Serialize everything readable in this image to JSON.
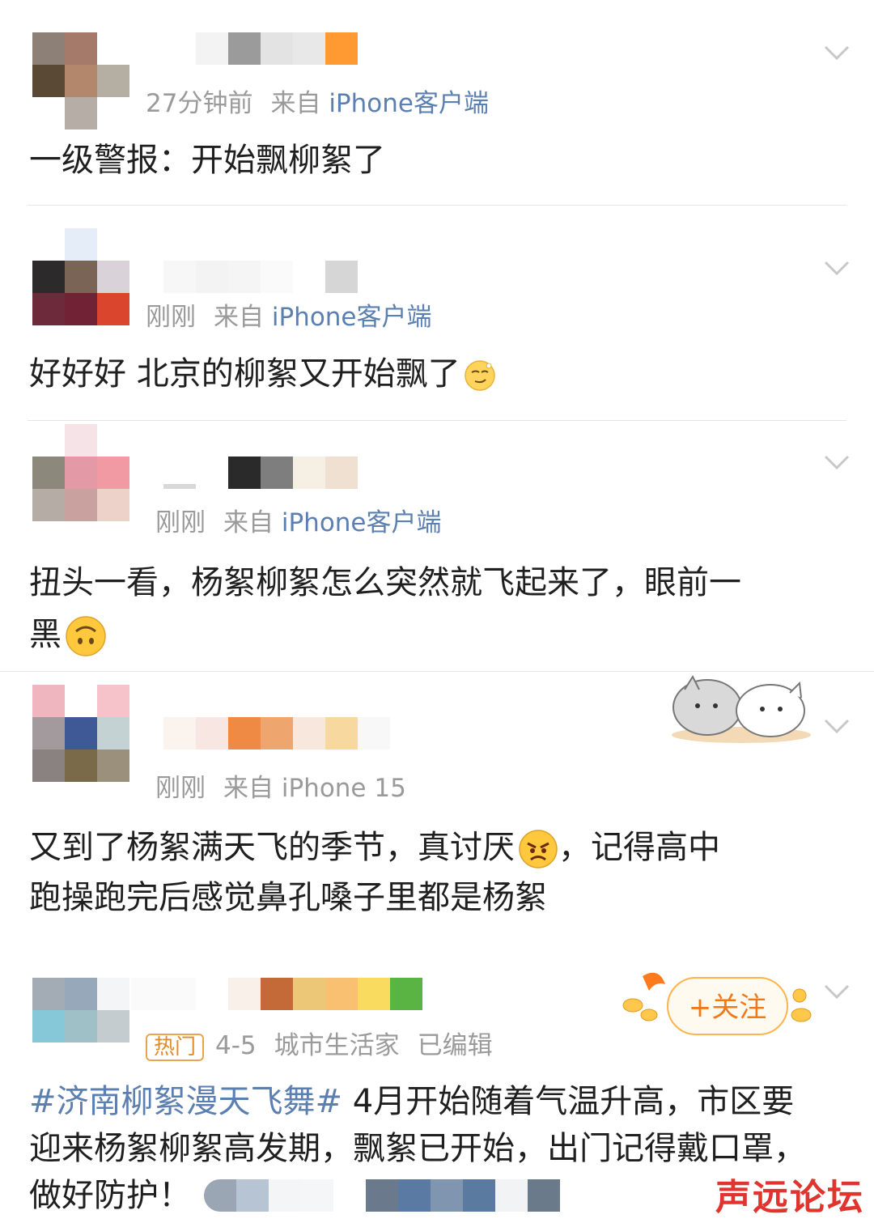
{
  "posts": [
    {
      "meta": {
        "time": "27分钟前",
        "from": "来自",
        "source": "iPhone客户端"
      },
      "text": "一级警报：开始飘柳絮了"
    },
    {
      "meta": {
        "time": "刚刚",
        "from": "来自",
        "source": "iPhone客户端"
      },
      "text": "好好好 北京的柳絮又开始飘了"
    },
    {
      "meta": {
        "time": "刚刚",
        "from": "来自",
        "source": "iPhone客户端"
      },
      "text_line1": "扭头一看，杨絮柳絮怎么突然就飞起来了，眼前一",
      "text_line2": "黑"
    },
    {
      "meta": {
        "time": "刚刚",
        "from": "来自",
        "source": "iPhone 15"
      },
      "text_line1a": "又到了杨絮满天飞的季节，真讨厌",
      "text_line1b": "，记得高中",
      "text_line2": "跑操跑完后感觉鼻孔嗓子里都是杨絮"
    },
    {
      "badge": "热门",
      "meta": {
        "date": "4-5",
        "author": "城市生活家",
        "edited": "已编辑"
      },
      "topic": "#济南柳絮漫天飞舞#",
      "text_line1": "4月开始随着气温升高，市区要",
      "text_line2": "迎来杨絮柳絮高发期，飘絮已开始，出门记得戴口罩，",
      "text_line3": "做好防护！",
      "follow_label": "+关注"
    }
  ],
  "watermark": "声远论坛",
  "colors": {
    "meta_gray": "#9a9a9a",
    "link_blue": "#5b7fb0",
    "follow_orange": "#f07a1a",
    "hot_badge": "#e08a2a",
    "watermark_red": "#e0342f"
  },
  "icons": [
    "chevron-down-icon",
    "smirk-emoji-icon",
    "upside-down-face-emoji-icon",
    "angry-face-emoji-icon",
    "cute-cats-sticker-icon"
  ]
}
